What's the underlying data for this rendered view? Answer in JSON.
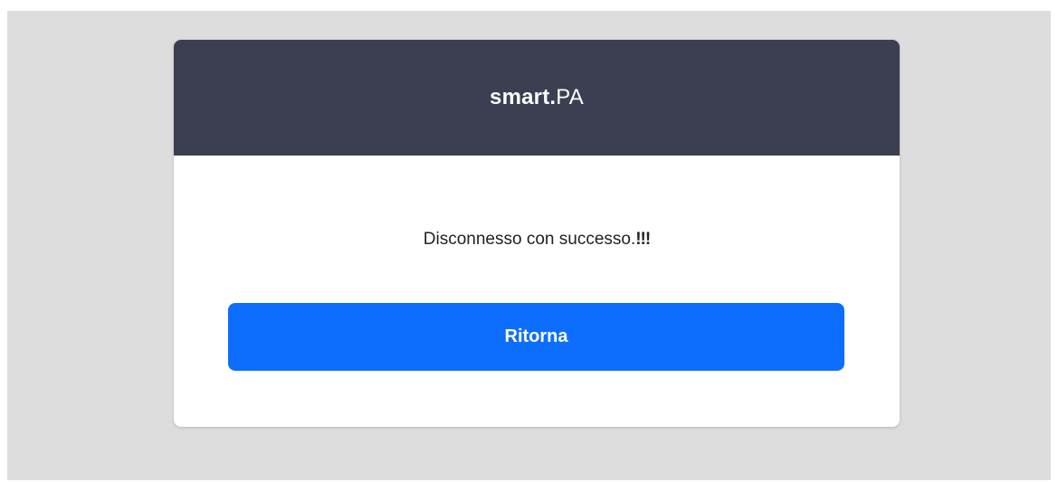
{
  "brand": {
    "strong": "smart.",
    "light": "PA"
  },
  "message": {
    "text": "Disconnesso con successo.",
    "emphasis": "!!!"
  },
  "actions": {
    "return_label": "Ritorna"
  },
  "colors": {
    "page_background": "#dddddd",
    "header_background": "#3b3f51",
    "primary": "#0d6efd"
  }
}
